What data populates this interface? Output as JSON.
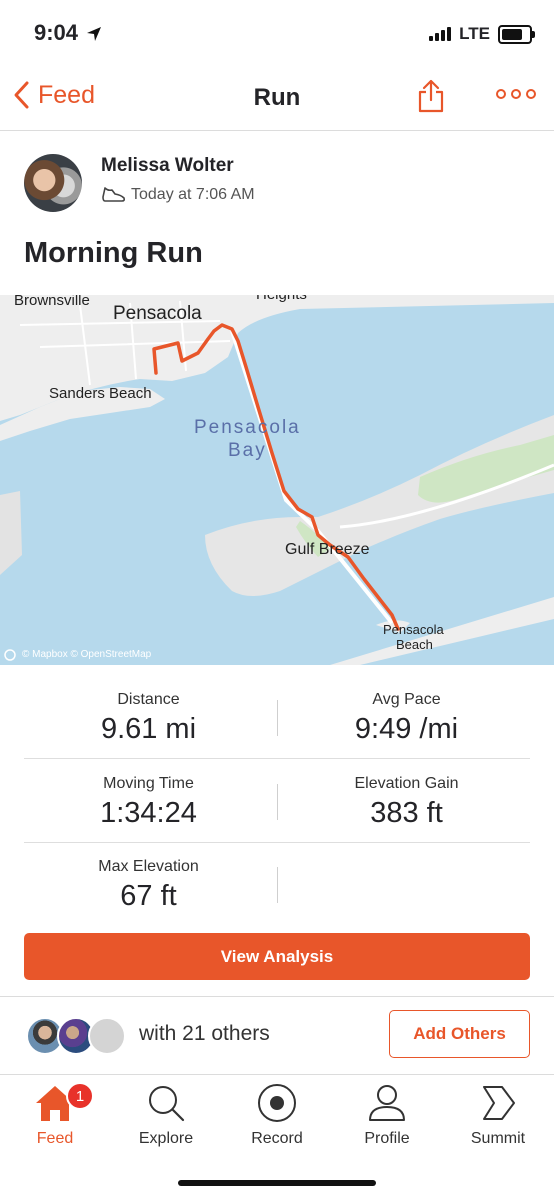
{
  "status_bar": {
    "time": "9:04",
    "network": "LTE"
  },
  "nav": {
    "back_label": "Feed",
    "title": "Run"
  },
  "athlete": {
    "name": "Melissa Wolter",
    "timestamp": "Today at 7:06 AM"
  },
  "activity": {
    "title": "Morning Run"
  },
  "map": {
    "labels": {
      "brownsville": "Brownsville",
      "heights": "Heights",
      "pensacola": "Pensacola",
      "sanders_beach": "Sanders Beach",
      "bay_line1": "Pensacola",
      "bay_line2": "Bay",
      "gulf_breeze": "Gulf Breeze",
      "pensacola_beach_line1": "Pensacola",
      "pensacola_beach_line2": "Beach"
    },
    "attribution": "© Mapbox © OpenStreetMap",
    "route_color": "#e8562a"
  },
  "stats": {
    "distance": {
      "label": "Distance",
      "value": "9.61 mi"
    },
    "avg_pace": {
      "label": "Avg Pace",
      "value": "9:49 /mi"
    },
    "moving_time": {
      "label": "Moving Time",
      "value": "1:34:24"
    },
    "elevation_gain": {
      "label": "Elevation Gain",
      "value": "383 ft"
    },
    "max_elevation": {
      "label": "Max Elevation",
      "value": "67 ft"
    }
  },
  "buttons": {
    "view_analysis": "View Analysis",
    "add_others": "Add Others"
  },
  "group": {
    "text": "with 21 others"
  },
  "tabbar": {
    "items": [
      {
        "label": "Feed",
        "icon": "home-icon",
        "badge": "1",
        "active": true
      },
      {
        "label": "Explore",
        "icon": "search-icon"
      },
      {
        "label": "Record",
        "icon": "record-icon"
      },
      {
        "label": "Profile",
        "icon": "profile-icon"
      },
      {
        "label": "Summit",
        "icon": "summit-icon"
      }
    ]
  },
  "colors": {
    "accent": "#e8562a",
    "badge": "#e8322a"
  }
}
